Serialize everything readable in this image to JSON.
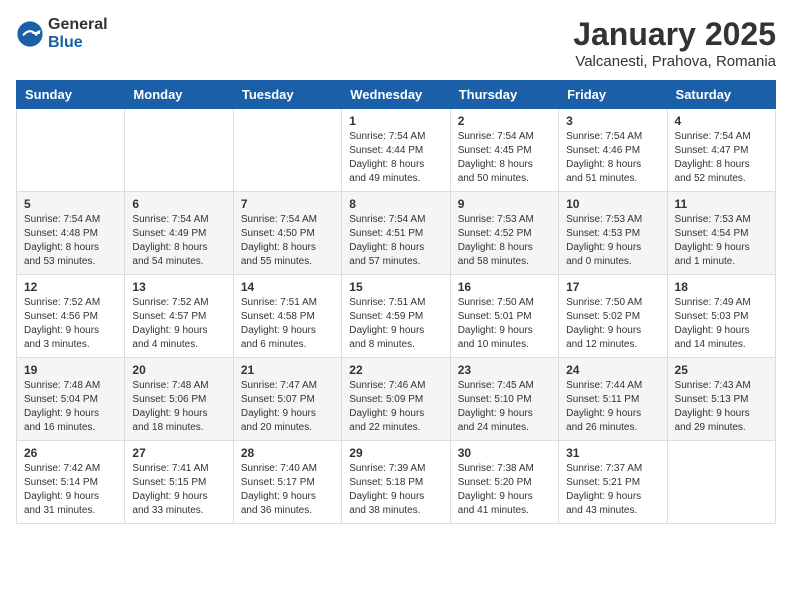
{
  "header": {
    "logo_general": "General",
    "logo_blue": "Blue",
    "title": "January 2025",
    "subtitle": "Valcanesti, Prahova, Romania"
  },
  "weekdays": [
    "Sunday",
    "Monday",
    "Tuesday",
    "Wednesday",
    "Thursday",
    "Friday",
    "Saturday"
  ],
  "weeks": [
    [
      {
        "day": "",
        "info": ""
      },
      {
        "day": "",
        "info": ""
      },
      {
        "day": "",
        "info": ""
      },
      {
        "day": "1",
        "info": "Sunrise: 7:54 AM\nSunset: 4:44 PM\nDaylight: 8 hours and 49 minutes."
      },
      {
        "day": "2",
        "info": "Sunrise: 7:54 AM\nSunset: 4:45 PM\nDaylight: 8 hours and 50 minutes."
      },
      {
        "day": "3",
        "info": "Sunrise: 7:54 AM\nSunset: 4:46 PM\nDaylight: 8 hours and 51 minutes."
      },
      {
        "day": "4",
        "info": "Sunrise: 7:54 AM\nSunset: 4:47 PM\nDaylight: 8 hours and 52 minutes."
      }
    ],
    [
      {
        "day": "5",
        "info": "Sunrise: 7:54 AM\nSunset: 4:48 PM\nDaylight: 8 hours and 53 minutes."
      },
      {
        "day": "6",
        "info": "Sunrise: 7:54 AM\nSunset: 4:49 PM\nDaylight: 8 hours and 54 minutes."
      },
      {
        "day": "7",
        "info": "Sunrise: 7:54 AM\nSunset: 4:50 PM\nDaylight: 8 hours and 55 minutes."
      },
      {
        "day": "8",
        "info": "Sunrise: 7:54 AM\nSunset: 4:51 PM\nDaylight: 8 hours and 57 minutes."
      },
      {
        "day": "9",
        "info": "Sunrise: 7:53 AM\nSunset: 4:52 PM\nDaylight: 8 hours and 58 minutes."
      },
      {
        "day": "10",
        "info": "Sunrise: 7:53 AM\nSunset: 4:53 PM\nDaylight: 9 hours and 0 minutes."
      },
      {
        "day": "11",
        "info": "Sunrise: 7:53 AM\nSunset: 4:54 PM\nDaylight: 9 hours and 1 minute."
      }
    ],
    [
      {
        "day": "12",
        "info": "Sunrise: 7:52 AM\nSunset: 4:56 PM\nDaylight: 9 hours and 3 minutes."
      },
      {
        "day": "13",
        "info": "Sunrise: 7:52 AM\nSunset: 4:57 PM\nDaylight: 9 hours and 4 minutes."
      },
      {
        "day": "14",
        "info": "Sunrise: 7:51 AM\nSunset: 4:58 PM\nDaylight: 9 hours and 6 minutes."
      },
      {
        "day": "15",
        "info": "Sunrise: 7:51 AM\nSunset: 4:59 PM\nDaylight: 9 hours and 8 minutes."
      },
      {
        "day": "16",
        "info": "Sunrise: 7:50 AM\nSunset: 5:01 PM\nDaylight: 9 hours and 10 minutes."
      },
      {
        "day": "17",
        "info": "Sunrise: 7:50 AM\nSunset: 5:02 PM\nDaylight: 9 hours and 12 minutes."
      },
      {
        "day": "18",
        "info": "Sunrise: 7:49 AM\nSunset: 5:03 PM\nDaylight: 9 hours and 14 minutes."
      }
    ],
    [
      {
        "day": "19",
        "info": "Sunrise: 7:48 AM\nSunset: 5:04 PM\nDaylight: 9 hours and 16 minutes."
      },
      {
        "day": "20",
        "info": "Sunrise: 7:48 AM\nSunset: 5:06 PM\nDaylight: 9 hours and 18 minutes."
      },
      {
        "day": "21",
        "info": "Sunrise: 7:47 AM\nSunset: 5:07 PM\nDaylight: 9 hours and 20 minutes."
      },
      {
        "day": "22",
        "info": "Sunrise: 7:46 AM\nSunset: 5:09 PM\nDaylight: 9 hours and 22 minutes."
      },
      {
        "day": "23",
        "info": "Sunrise: 7:45 AM\nSunset: 5:10 PM\nDaylight: 9 hours and 24 minutes."
      },
      {
        "day": "24",
        "info": "Sunrise: 7:44 AM\nSunset: 5:11 PM\nDaylight: 9 hours and 26 minutes."
      },
      {
        "day": "25",
        "info": "Sunrise: 7:43 AM\nSunset: 5:13 PM\nDaylight: 9 hours and 29 minutes."
      }
    ],
    [
      {
        "day": "26",
        "info": "Sunrise: 7:42 AM\nSunset: 5:14 PM\nDaylight: 9 hours and 31 minutes."
      },
      {
        "day": "27",
        "info": "Sunrise: 7:41 AM\nSunset: 5:15 PM\nDaylight: 9 hours and 33 minutes."
      },
      {
        "day": "28",
        "info": "Sunrise: 7:40 AM\nSunset: 5:17 PM\nDaylight: 9 hours and 36 minutes."
      },
      {
        "day": "29",
        "info": "Sunrise: 7:39 AM\nSunset: 5:18 PM\nDaylight: 9 hours and 38 minutes."
      },
      {
        "day": "30",
        "info": "Sunrise: 7:38 AM\nSunset: 5:20 PM\nDaylight: 9 hours and 41 minutes."
      },
      {
        "day": "31",
        "info": "Sunrise: 7:37 AM\nSunset: 5:21 PM\nDaylight: 9 hours and 43 minutes."
      },
      {
        "day": "",
        "info": ""
      }
    ]
  ]
}
